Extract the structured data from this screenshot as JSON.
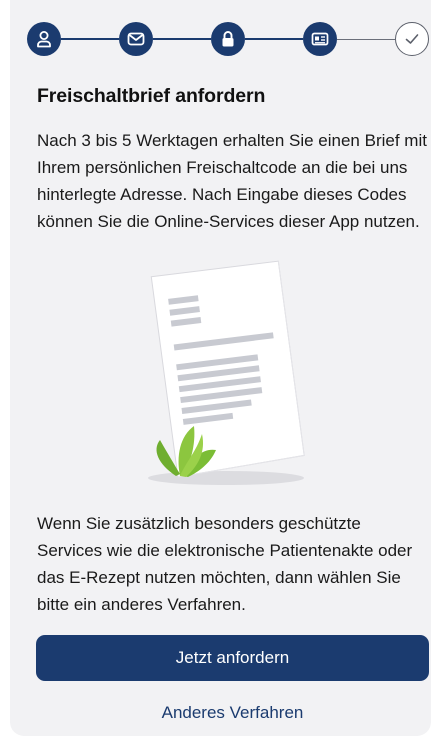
{
  "stepper": {
    "steps": [
      {
        "icon": "person-icon",
        "state": "done"
      },
      {
        "icon": "mail-icon",
        "state": "done"
      },
      {
        "icon": "lock-icon",
        "state": "current"
      },
      {
        "icon": "id-card-icon",
        "state": "done"
      },
      {
        "icon": "checkmark-icon",
        "state": "pending"
      }
    ],
    "colors": {
      "active": "#1b3b6f",
      "inactive": "#5c606b"
    }
  },
  "header": {
    "title": "Freischaltbrief anfordern"
  },
  "content": {
    "intro": "Nach 3 bis 5 Werktagen erhalten Sie einen Brief mit Ihrem persönlichen Freischaltcode an die bei uns hinterlegte Adresse. Nach Eingabe dieses Codes können Sie die Online-Services dieser App nutzen.",
    "note": "Wenn Sie zusätzlich besonders geschützte Services wie die elektronische Patientenakte oder das E-Rezept nutzen möchten, dann wählen Sie bitte ein anderes Verfahren."
  },
  "actions": {
    "primary_label": "Jetzt anfordern",
    "secondary_label": "Anderes Verfahren"
  },
  "colors": {
    "brand": "#1b3b6f",
    "background": "#f2f2f4",
    "plant": "#8cc63f"
  }
}
